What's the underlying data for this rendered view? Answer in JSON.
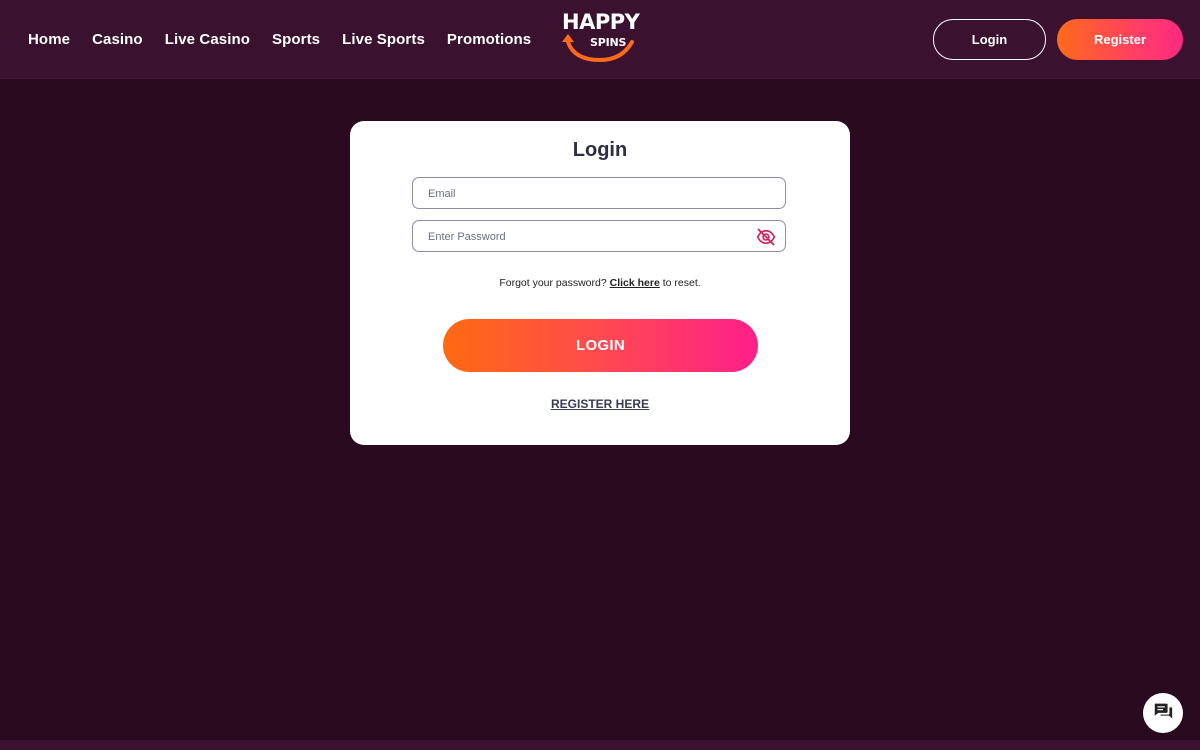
{
  "nav": {
    "items": [
      {
        "label": "Home"
      },
      {
        "label": "Casino"
      },
      {
        "label": "Live Casino"
      },
      {
        "label": "Sports"
      },
      {
        "label": "Live Sports"
      },
      {
        "label": "Promotions"
      }
    ]
  },
  "logo": {
    "line1": "HAPPY",
    "line2": "SPINS"
  },
  "header": {
    "login_label": "Login",
    "register_label": "Register"
  },
  "login_form": {
    "title": "Login",
    "email_placeholder": "Email",
    "password_placeholder": "Enter Password",
    "forgot_prefix": "Forgot your password?",
    "forgot_link": "Click here",
    "forgot_suffix": "to reset.",
    "submit_label": "LOGIN",
    "register_link": "REGISTER HERE"
  },
  "icons": {
    "password_toggle": "eye-off-icon",
    "chat": "chat-icon"
  },
  "colors": {
    "page_bg": "#2a0a1f",
    "header_bg": "#3a1230",
    "accent_orange": "#ff6a12",
    "accent_pink": "#ff1f8a",
    "eye_icon": "#d6245f"
  }
}
